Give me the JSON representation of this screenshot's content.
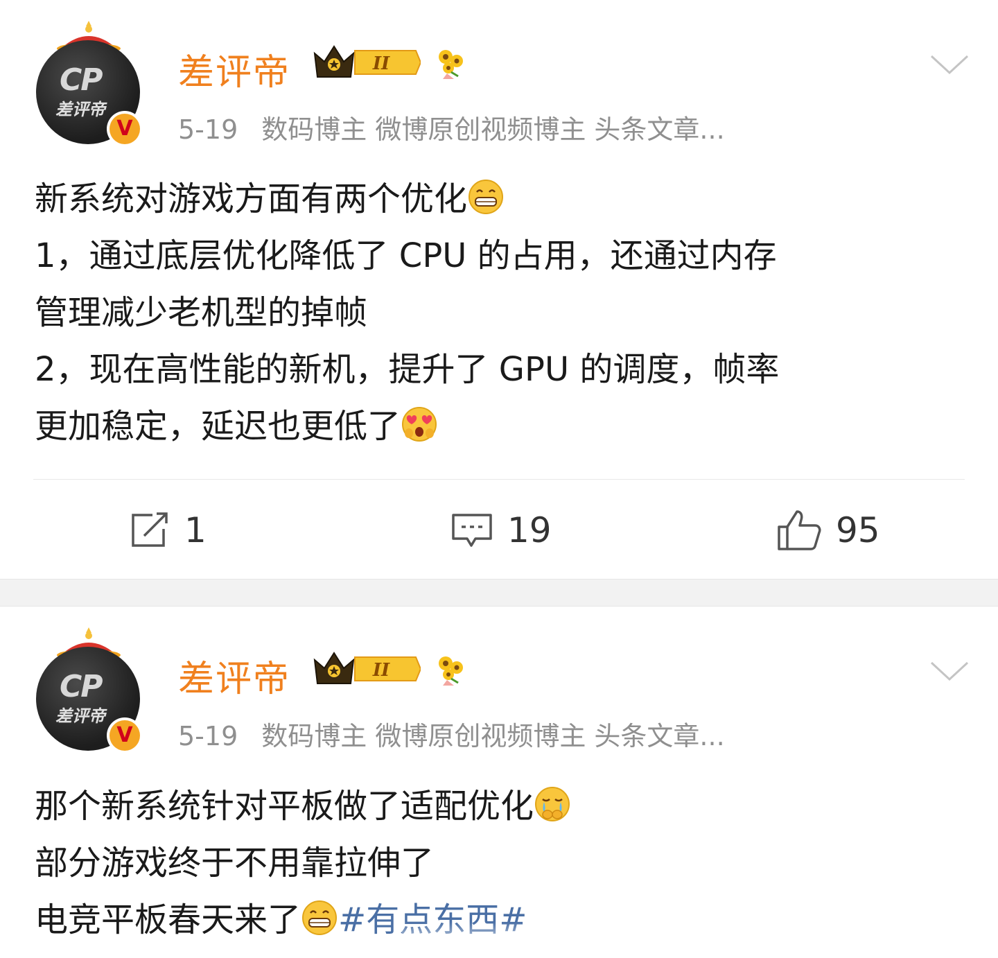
{
  "posts": [
    {
      "username": "差评帝",
      "date": "5-19",
      "tags": "数码博主 微博原创视频博主 头条文章...",
      "lines": [
        "新系统对游戏方面有两个优化",
        "1，通过底层优化降低了 CPU 的占用，还通过内存",
        "管理减少老机型的掉帧",
        "2，现在高性能的新机，提升了 GPU 的调度，帧率",
        "更加稳定，延迟也更低了"
      ],
      "emojis": [
        "grin-emoji",
        "heart-eyes-emoji"
      ],
      "actions": {
        "repost": "1",
        "comment": "19",
        "like": "95"
      }
    },
    {
      "username": "差评帝",
      "date": "5-19",
      "tags": "数码博主 微博原创视频博主 头条文章...",
      "lines": [
        "那个新系统针对平板做了适配优化",
        "部分游戏终于不用靠拉伸了",
        "电竞平板春天来了"
      ],
      "hashtag": "#有点东西#",
      "emojis": [
        "crying-emoji",
        "grin-emoji"
      ]
    }
  ],
  "avatar": {
    "logo_text": "CP",
    "name_text": "差评帝"
  },
  "badges": {
    "vip_level": "II",
    "verified": "V"
  },
  "colors": {
    "username": "#f0801e",
    "meta": "#8f8f8f",
    "hashtag": "#4a6fa5",
    "divider": "#f2f2f2"
  }
}
